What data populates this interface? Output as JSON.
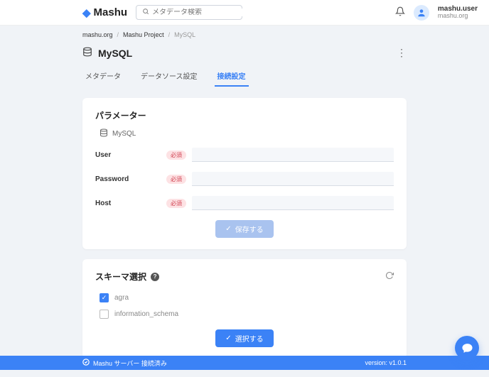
{
  "header": {
    "brand": "Mashu",
    "search_placeholder": "メタデータ検索",
    "user_name": "mashu.user",
    "user_org": "mashu.org"
  },
  "breadcrumb": {
    "items": [
      "mashu.org",
      "Mashu Project",
      "MySQL"
    ]
  },
  "page": {
    "title": "MySQL"
  },
  "tabs": {
    "items": [
      {
        "label": "メタデータ",
        "active": false
      },
      {
        "label": "データソース設定",
        "active": false
      },
      {
        "label": "接続設定",
        "active": true
      }
    ]
  },
  "params_card": {
    "title": "パラメーター",
    "db_label": "MySQL",
    "required_badge": "必須",
    "fields": {
      "user_label": "User",
      "password_label": "Password",
      "host_label": "Host"
    },
    "save_label": "保存する"
  },
  "schema_card": {
    "title": "スキーマ選択",
    "items": [
      {
        "label": "agra",
        "checked": true
      },
      {
        "label": "information_schema",
        "checked": false
      }
    ],
    "select_label": "選択する"
  },
  "footer": {
    "status": "Mashu サーバー 接続済み",
    "version": "version: v1.0.1"
  }
}
